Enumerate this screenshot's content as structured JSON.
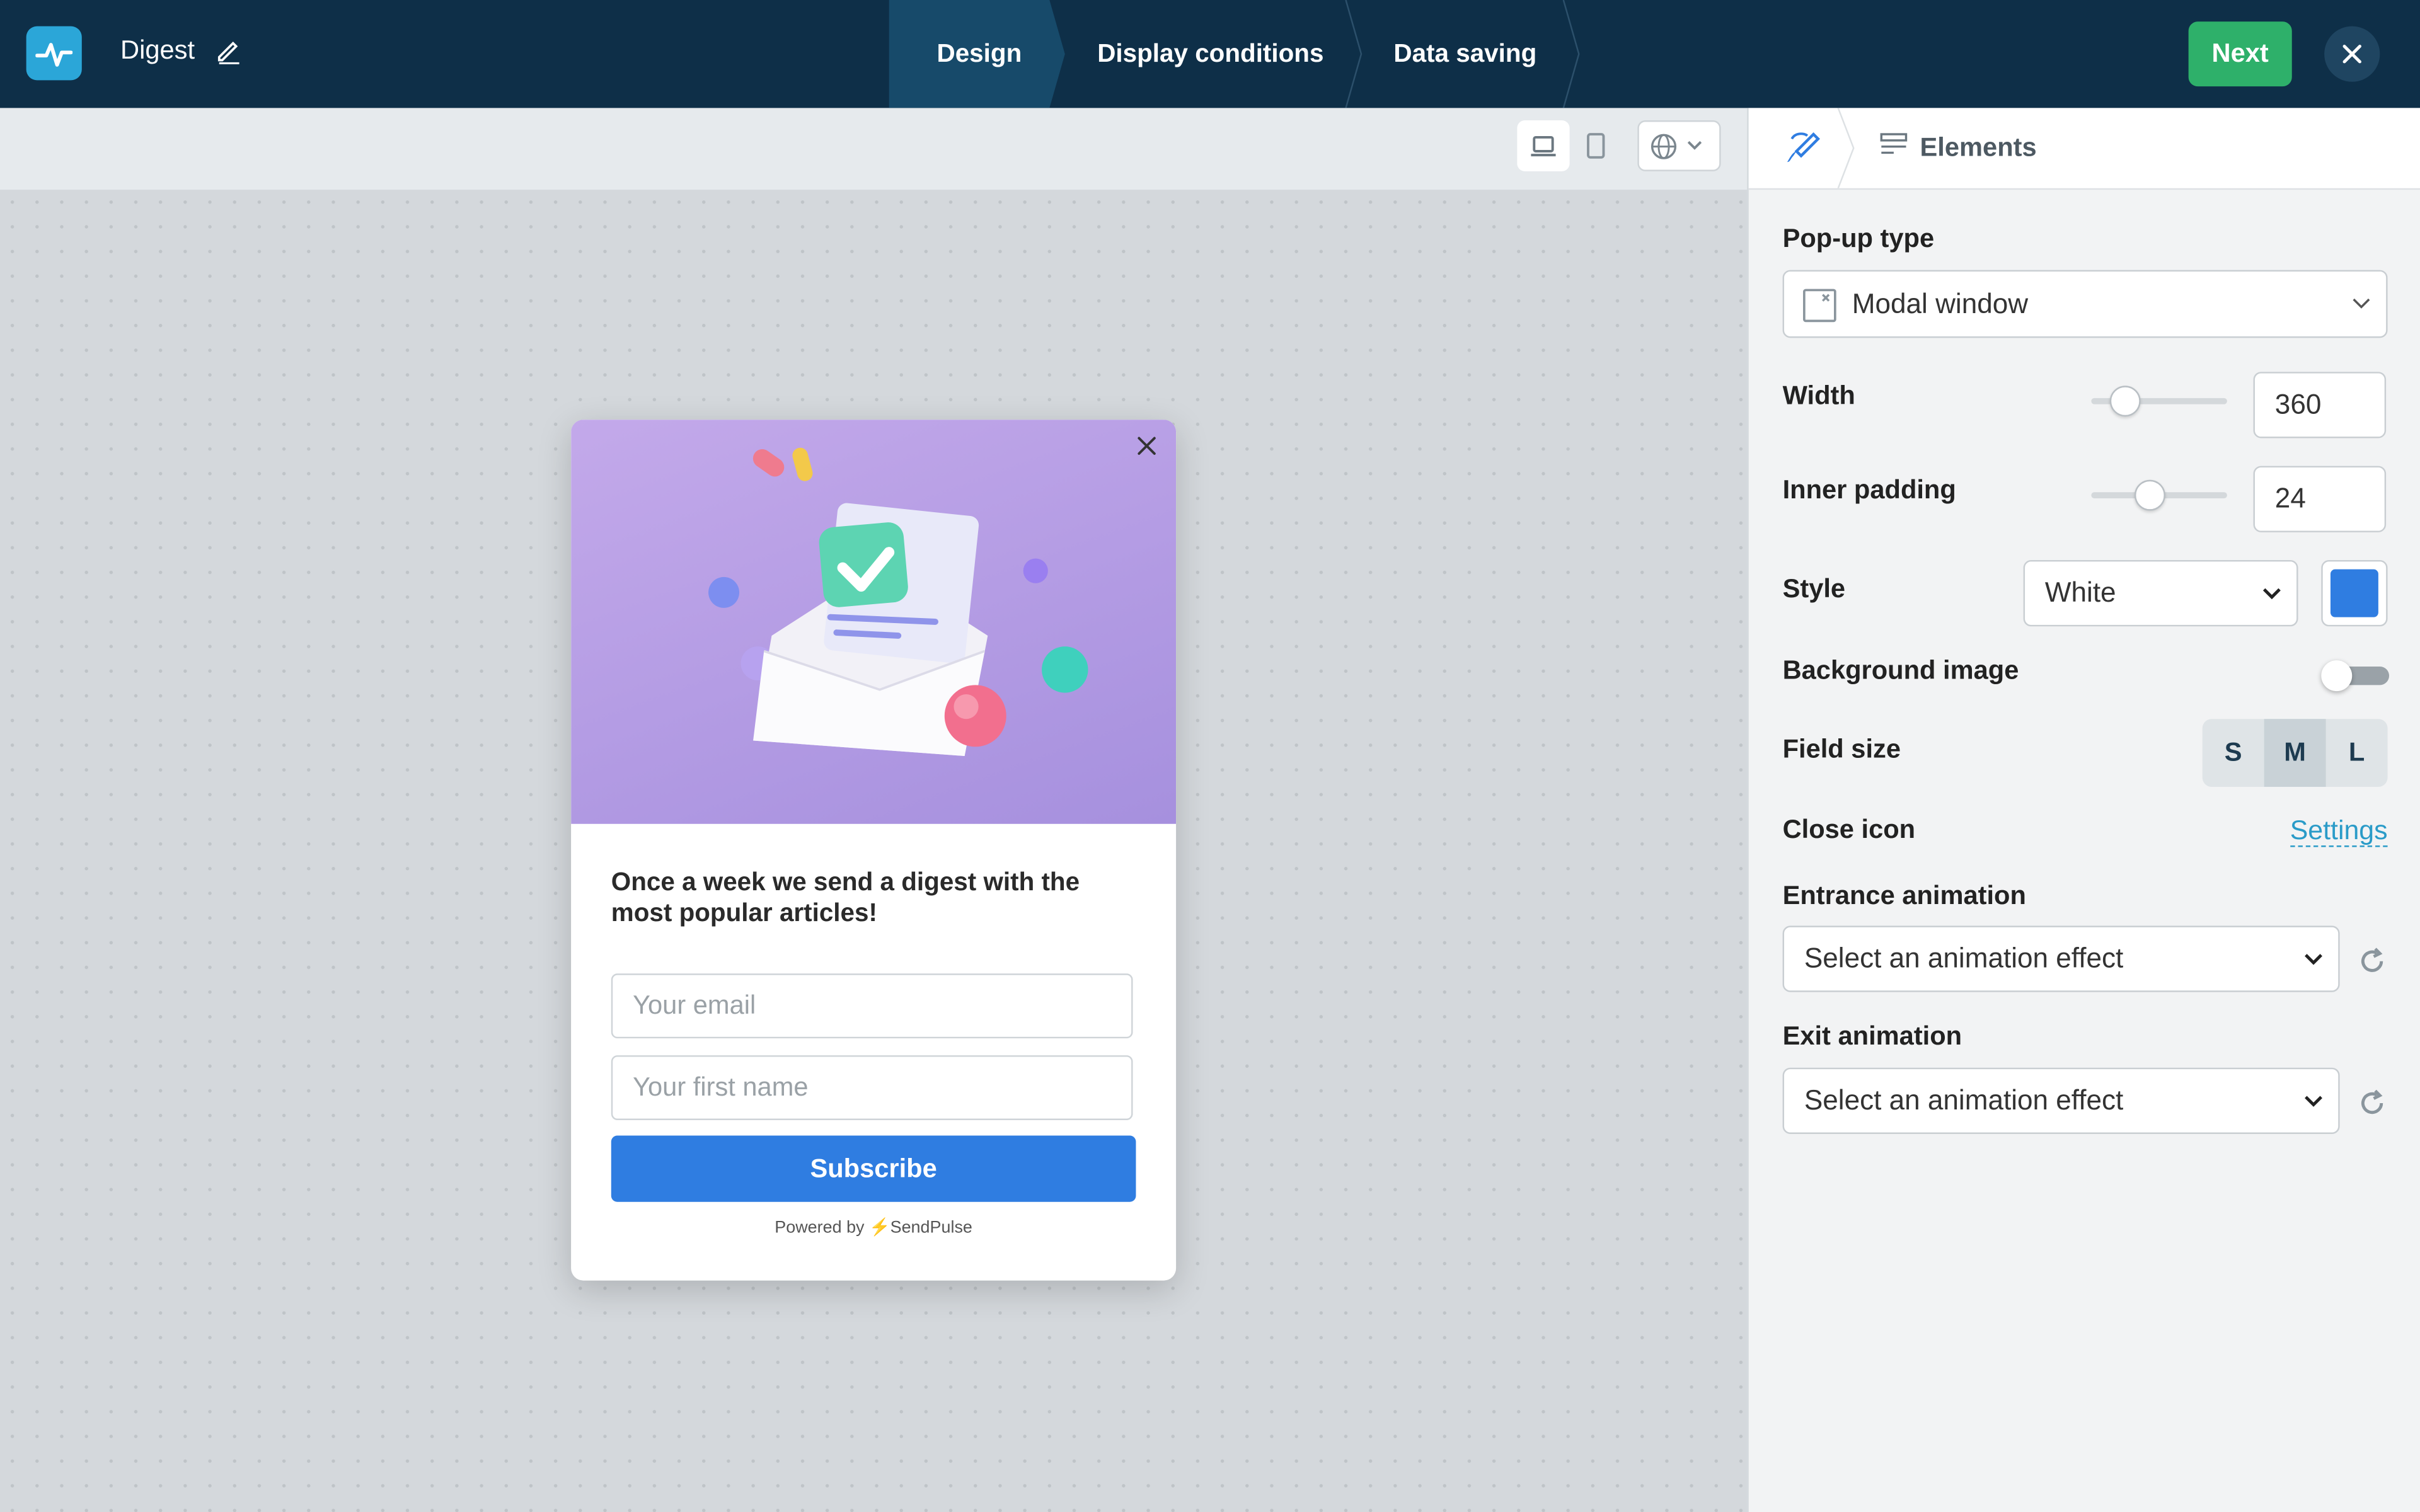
{
  "app": {
    "title": "Digest"
  },
  "steps": [
    {
      "label": "Design",
      "active": true
    },
    {
      "label": "Display conditions",
      "active": false
    },
    {
      "label": "Data saving",
      "active": false
    }
  ],
  "header": {
    "next_label": "Next"
  },
  "popup": {
    "headline": "Once a week we send a digest with the most popular articles!",
    "email_placeholder": "Your email",
    "name_placeholder": "Your first name",
    "subscribe_label": "Subscribe",
    "powered_prefix": "Powered by",
    "powered_brand": "SendPulse"
  },
  "panel": {
    "tab_elements": "Elements",
    "popup_type_label": "Pop-up type",
    "popup_type_value": "Modal window",
    "width_label": "Width",
    "width_value": "360",
    "padding_label": "Inner padding",
    "padding_value": "24",
    "style_label": "Style",
    "style_value": "White",
    "style_color": "#2f7de1",
    "bg_image_label": "Background image",
    "bg_image_enabled": false,
    "field_size_label": "Field size",
    "field_sizes": [
      "S",
      "M",
      "L"
    ],
    "field_size_selected": "M",
    "close_icon_label": "Close icon",
    "close_icon_link": "Settings",
    "entrance_label": "Entrance animation",
    "entrance_value": "Select an animation effect",
    "exit_label": "Exit animation",
    "exit_value": "Select an animation effect"
  },
  "colors": {
    "topbar": "#0e2f48",
    "accent": "#2eb06a",
    "primary": "#2f7de1",
    "link": "#2a9bc8"
  }
}
